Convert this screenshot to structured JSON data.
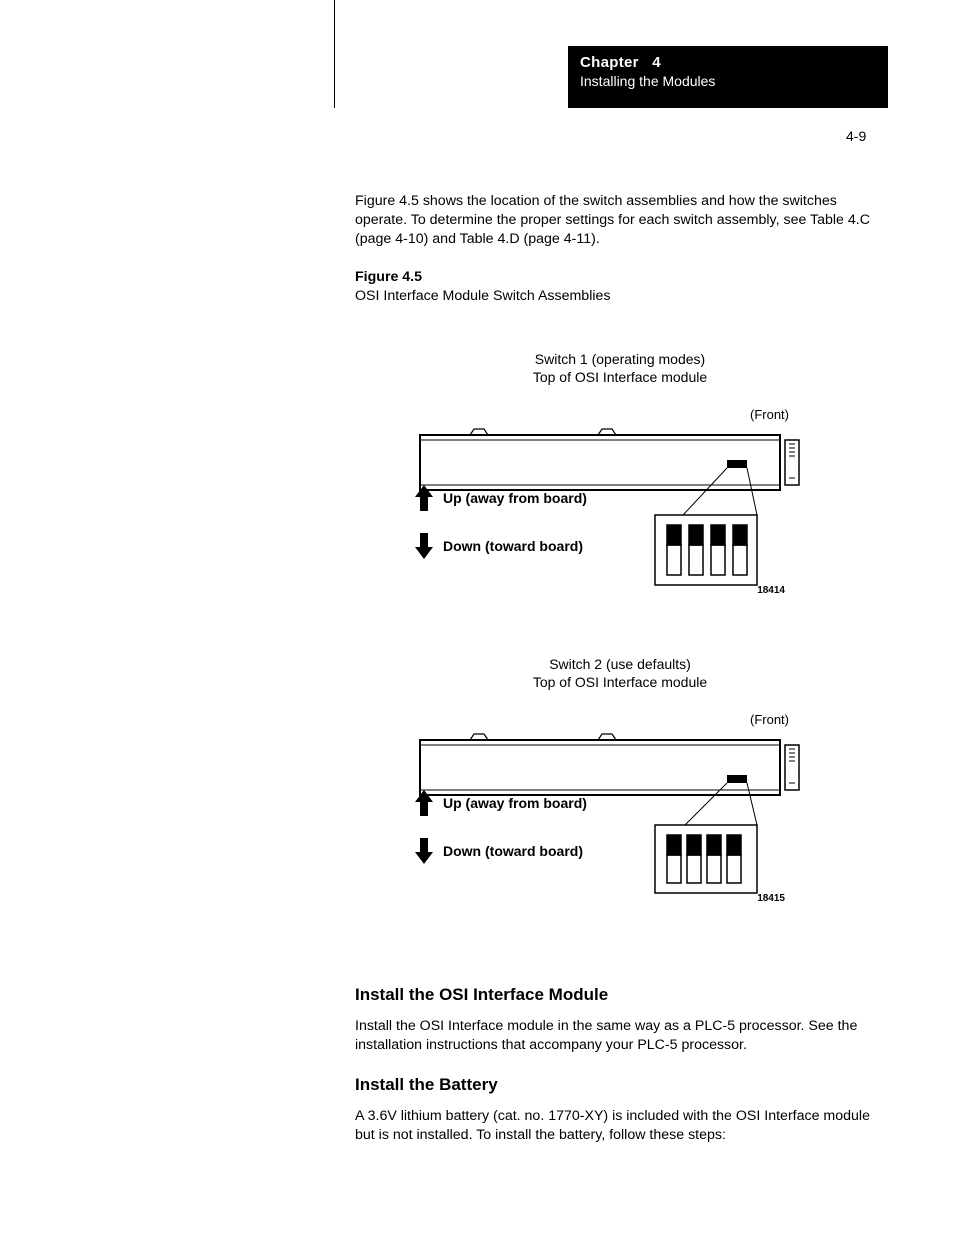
{
  "header": {
    "chapter_label": "Chapter",
    "chapter_num": "4",
    "title": "Installing the Modules"
  },
  "page_number": "4-9",
  "intro_paragraph": "Figure 4.5 shows the location of the switch assemblies and how the switches operate. To determine the proper settings for each switch assembly, see Table 4.C (page 4-10) and Table 4.D (page 4-11).",
  "figure_lead": {
    "label": "Figure 4.5",
    "title": "OSI Interface Module Switch Assemblies"
  },
  "figures": [
    {
      "caption_line1": "Switch 1 (operating modes)",
      "caption_line2": "Top of OSI Interface module",
      "front_label": "(Front)",
      "legend_up": "Up (away from board)",
      "legend_down": "Down (toward board)",
      "id": "18414"
    },
    {
      "caption_line1": "Switch 2 (use defaults)",
      "caption_line2": "Top of OSI Interface module",
      "front_label": "(Front)",
      "legend_up": "Up (away from board)",
      "legend_down": "Down (toward board)",
      "id": "18415"
    }
  ],
  "sections": [
    {
      "heading": "Install the OSI Interface Module",
      "paragraph": "Install the OSI Interface module in the same way as a PLC-5 processor. See the installation instructions that accompany your PLC-5 processor."
    },
    {
      "heading": "Install the Battery",
      "paragraph": "A 3.6V lithium battery (cat. no. 1770-XY) is included with the OSI Interface module but is not installed. To install the battery, follow these steps:"
    }
  ]
}
